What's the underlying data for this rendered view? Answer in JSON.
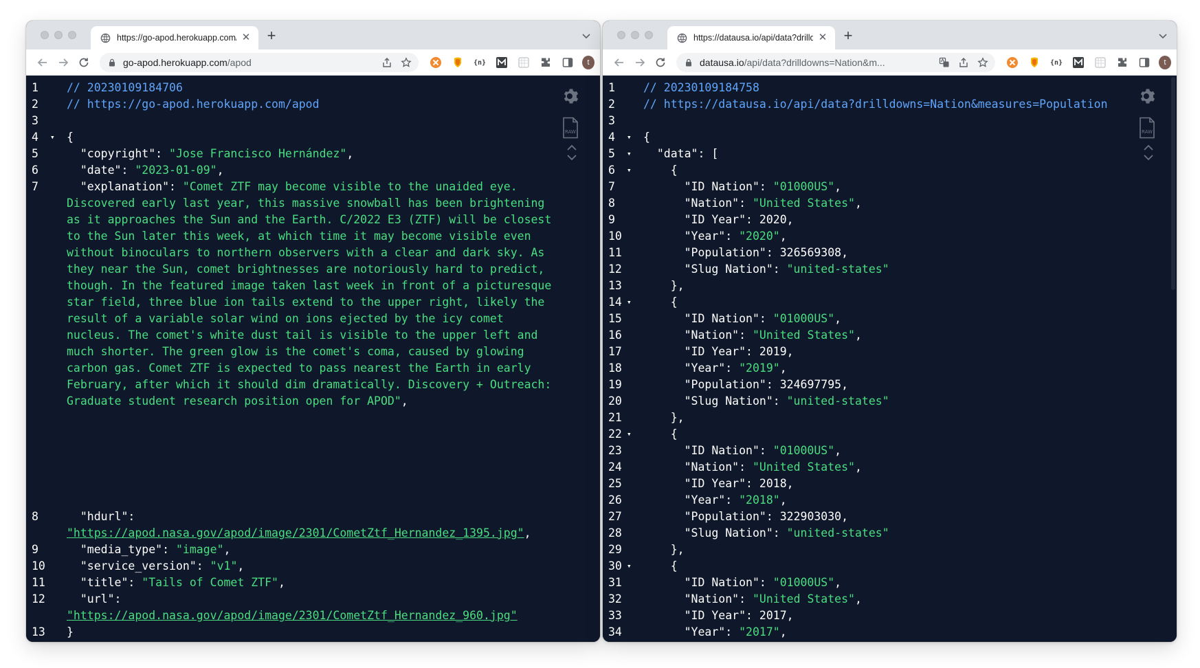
{
  "left": {
    "tab_title": "https://go-apod.herokuapp.com/apod",
    "url_host": "go-apod.herokuapp.com",
    "url_path": "/apod",
    "lines": [
      {
        "n": "1",
        "fold": "",
        "text": "// 20230109184706"
      },
      {
        "n": "2",
        "fold": "",
        "text": "// https://go-apod.herokuapp.com/apod"
      },
      {
        "n": "3",
        "fold": "",
        "text": ""
      },
      {
        "n": "4",
        "fold": "▾",
        "text": "{"
      },
      {
        "n": "5",
        "fold": "",
        "key": "\"copyright\"",
        "val": "\"Jose Francisco Hernández\""
      },
      {
        "n": "6",
        "fold": "",
        "key": "\"date\"",
        "val": "\"2023-01-09\""
      },
      {
        "n": "7",
        "fold": "",
        "key": "\"explanation\"",
        "val": "\"Comet ZTF may become visible to the unaided eye. Discovered early last year, this massive snowball has been brightening as it approaches the Sun and the Earth. C/2022 E3 (ZTF) will be closest to the Sun later this week, at which time it may become visible even without binoculars to northern observers with a clear and dark sky. As they near the Sun, comet brightnesses are notoriously hard to predict, though. In the featured image taken last week in front of a picturesque star field, three blue ion tails extend to the upper right, likely the result of a variable solar wind on ions ejected by the icy comet nucleus.  The comet's white dust tail is visible to the upper left and much shorter. The green glow is the comet's coma, caused by glowing carbon gas. Comet ZTF is expected to pass nearest the Earth in early February, after which it should dim dramatically.   Discovery + Outreach: Graduate student research position open for APOD\""
      },
      {
        "n": "8",
        "fold": "",
        "key": "\"hdurl\"",
        "val": "\"https://apod.nasa.gov/apod/image/2301/CometZtf_Hernandez_1395.jpg\""
      },
      {
        "n": "9",
        "fold": "",
        "key": "\"media_type\"",
        "val": "\"image\""
      },
      {
        "n": "10",
        "fold": "",
        "key": "\"service_version\"",
        "val": "\"v1\""
      },
      {
        "n": "11",
        "fold": "",
        "key": "\"title\"",
        "val": "\"Tails of Comet ZTF\""
      },
      {
        "n": "12",
        "fold": "",
        "key": "\"url\"",
        "val": "\"https://apod.nasa.gov/apod/image/2301/CometZtf_Hernandez_960.jpg\""
      },
      {
        "n": "13",
        "fold": "",
        "text": "}"
      }
    ]
  },
  "right": {
    "tab_title": "https://datausa.io/api/data?drilldowns=Nation&measures=Population",
    "url_host": "datausa.io",
    "url_path": "/api/data?drilldowns=Nation&m...",
    "header_lines": [
      "// 20230109184758",
      "// https://datausa.io/api/data?drilldowns=Nation&measures=Population"
    ],
    "records": [
      {
        "id_nation": "\"01000US\"",
        "nation": "\"United States\"",
        "id_year": "2020",
        "year": "\"2020\"",
        "population": "326569308",
        "slug": "\"united-states\""
      },
      {
        "id_nation": "\"01000US\"",
        "nation": "\"United States\"",
        "id_year": "2019",
        "year": "\"2019\"",
        "population": "324697795",
        "slug": "\"united-states\""
      },
      {
        "id_nation": "\"01000US\"",
        "nation": "\"United States\"",
        "id_year": "2018",
        "year": "\"2018\"",
        "population": "322903030",
        "slug": "\"united-states\""
      },
      {
        "id_nation": "\"01000US\"",
        "nation": "\"United States\"",
        "id_year": "2017",
        "year": "\"2017\""
      }
    ],
    "labels": {
      "data": "\"data\"",
      "id_nation": "\"ID Nation\"",
      "nation": "\"Nation\"",
      "id_year": "\"ID Year\"",
      "year": "\"Year\"",
      "population": "\"Population\"",
      "slug": "\"Slug Nation\""
    }
  },
  "shared": {
    "avatar_initial": "t",
    "raw_label": "RAW",
    "colors": {
      "background": "#0f172a",
      "comment": "#60a5fa",
      "string": "#4ade80",
      "key": "#ffffff",
      "tabstrip": "#dee1e6"
    },
    "icons": [
      "globe-icon",
      "close-icon",
      "plus-icon",
      "chevron-down-icon",
      "back-icon",
      "forward-icon",
      "reload-icon",
      "lock-icon",
      "share-icon",
      "star-icon",
      "translate-icon",
      "extension-icon",
      "sidepanel-icon",
      "gear-icon",
      "raw-file-icon",
      "chevron-up-icon"
    ]
  }
}
